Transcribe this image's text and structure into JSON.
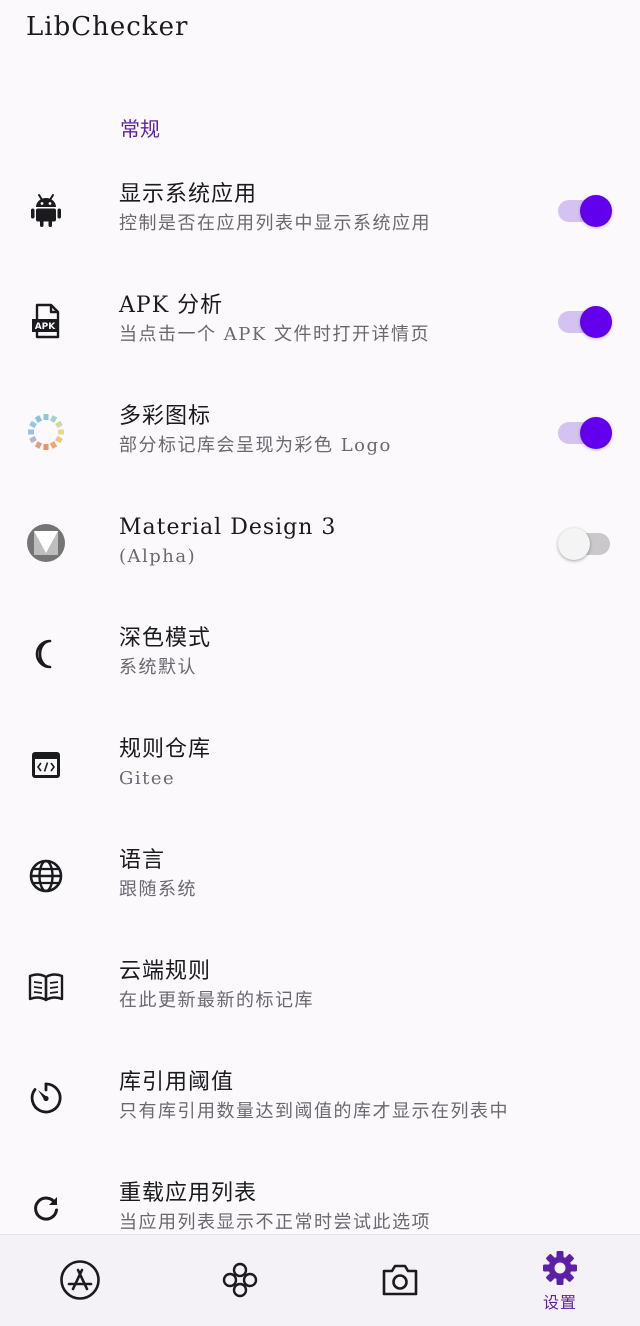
{
  "app": {
    "title": "LibChecker"
  },
  "section": {
    "title": "常规"
  },
  "items": [
    {
      "title": "显示系统应用",
      "subtitle": "控制是否在应用列表中显示系统应用",
      "icon": "android-icon",
      "toggle": true
    },
    {
      "title": "APK 分析",
      "subtitle": "当点击一个 APK 文件时打开详情页",
      "icon": "apk-file-icon",
      "icon_text": "APK",
      "toggle": true
    },
    {
      "title": "多彩图标",
      "subtitle": "部分标记库会呈现为彩色 Logo",
      "icon": "colorful-ring-icon",
      "toggle": true
    },
    {
      "title": "Material Design 3",
      "subtitle": "(Alpha)",
      "icon": "material-logo-icon",
      "toggle": false
    },
    {
      "title": "深色模式",
      "subtitle": "系统默认",
      "icon": "moon-icon"
    },
    {
      "title": "规则仓库",
      "subtitle": "Gitee",
      "icon": "code-window-icon"
    },
    {
      "title": "语言",
      "subtitle": "跟随系统",
      "icon": "globe-icon"
    },
    {
      "title": "云端规则",
      "subtitle": "在此更新最新的标记库",
      "icon": "book-icon"
    },
    {
      "title": "库引用阈值",
      "subtitle": "只有库引用数量达到阈值的库才显示在列表中",
      "icon": "timer-icon"
    },
    {
      "title": "重载应用列表",
      "subtitle": "当应用列表显示不正常时尝试此选项",
      "icon": "refresh-icon"
    }
  ],
  "bottom_nav": {
    "items": [
      {
        "icon": "app-store-icon",
        "label": ""
      },
      {
        "icon": "clover-icon",
        "label": ""
      },
      {
        "icon": "camera-icon",
        "label": ""
      },
      {
        "icon": "settings-gear-icon",
        "label": "设置",
        "active": true
      }
    ]
  },
  "colors": {
    "accent": "#6200ee",
    "accent_track": "#d4c3f0",
    "section_header": "#5e1fa8",
    "background": "#fbf9fc"
  }
}
